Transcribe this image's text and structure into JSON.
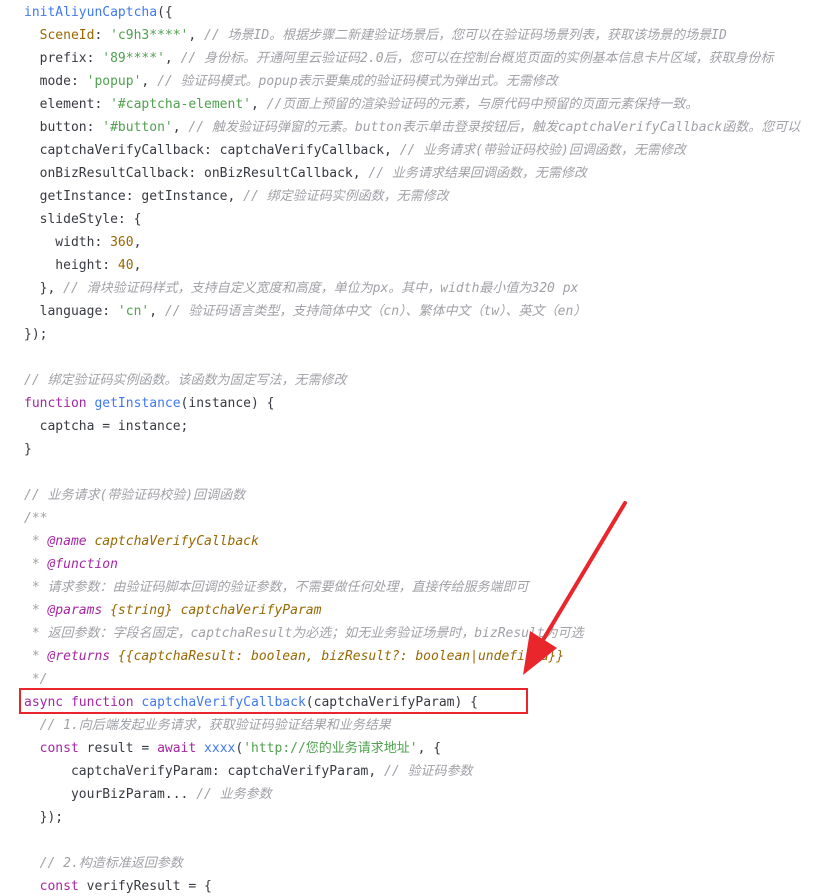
{
  "code": {
    "lines": [
      [
        [
          "fn",
          "initAliyunCaptcha"
        ],
        [
          "pl",
          "({"
        ]
      ],
      [
        [
          "pl",
          "  "
        ],
        [
          "var",
          "SceneId"
        ],
        [
          "pl",
          ": "
        ],
        [
          "str",
          "'c9h3****'"
        ],
        [
          "pl",
          ", "
        ],
        [
          "cm",
          "// 场景ID。根据步骤二新建验证场景后，您可以在验证码场景列表，获取该场景的场景ID"
        ]
      ],
      [
        [
          "pl",
          "  prefix: "
        ],
        [
          "str",
          "'89****'"
        ],
        [
          "pl",
          ", "
        ],
        [
          "cm",
          "// 身份标。开通阿里云验证码2.0后，您可以在控制台概览页面的实例基本信息卡片区域，获取身份标"
        ]
      ],
      [
        [
          "pl",
          "  mode: "
        ],
        [
          "str",
          "'popup'"
        ],
        [
          "pl",
          ", "
        ],
        [
          "cm",
          "// 验证码模式。popup表示要集成的验证码模式为弹出式。无需修改"
        ]
      ],
      [
        [
          "pl",
          "  element: "
        ],
        [
          "str",
          "'#captcha-element'"
        ],
        [
          "pl",
          ", "
        ],
        [
          "cm",
          "//页面上预留的渲染验证码的元素，与原代码中预留的页面元素保持一致。"
        ]
      ],
      [
        [
          "pl",
          "  button: "
        ],
        [
          "str",
          "'#button'"
        ],
        [
          "pl",
          ", "
        ],
        [
          "cm",
          "// 触发验证码弹窗的元素。button表示单击登录按钮后，触发captchaVerifyCallback函数。您可以"
        ]
      ],
      [
        [
          "pl",
          "  captchaVerifyCallback: captchaVerifyCallback, "
        ],
        [
          "cm",
          "// 业务请求(带验证码校验)回调函数，无需修改"
        ]
      ],
      [
        [
          "pl",
          "  onBizResultCallback: onBizResultCallback, "
        ],
        [
          "cm",
          "// 业务请求结果回调函数，无需修改"
        ]
      ],
      [
        [
          "pl",
          "  getInstance: getInstance, "
        ],
        [
          "cm",
          "// 绑定验证码实例函数，无需修改"
        ]
      ],
      [
        [
          "pl",
          "  slideStyle: {"
        ]
      ],
      [
        [
          "pl",
          "    width: "
        ],
        [
          "num",
          "360"
        ],
        [
          "pl",
          ","
        ]
      ],
      [
        [
          "pl",
          "    height: "
        ],
        [
          "num",
          "40"
        ],
        [
          "pl",
          ","
        ]
      ],
      [
        [
          "pl",
          "  }, "
        ],
        [
          "cm",
          "// 滑块验证码样式，支持自定义宽度和高度，单位为px。其中，width最小值为320 px"
        ]
      ],
      [
        [
          "pl",
          "  language: "
        ],
        [
          "str",
          "'cn'"
        ],
        [
          "pl",
          ", "
        ],
        [
          "cm",
          "// 验证码语言类型，支持简体中文（cn）、繁体中文（tw）、英文（en）"
        ]
      ],
      [
        [
          "pl",
          "});"
        ]
      ],
      [],
      [
        [
          "cm",
          "// 绑定验证码实例函数。该函数为固定写法，无需修改"
        ]
      ],
      [
        [
          "kw",
          "function"
        ],
        [
          "pl",
          " "
        ],
        [
          "fn",
          "getInstance"
        ],
        [
          "pl",
          "(instance) {"
        ]
      ],
      [
        [
          "pl",
          "  captcha = instance;"
        ]
      ],
      [
        [
          "pl",
          "}"
        ]
      ],
      [],
      [
        [
          "cm",
          "// 业务请求(带验证码校验)回调函数"
        ]
      ],
      [
        [
          "cm",
          "/**"
        ]
      ],
      [
        [
          "cm",
          " * "
        ],
        [
          "tag",
          "@name"
        ],
        [
          "cm",
          " "
        ],
        [
          "type",
          "captchaVerifyCallback"
        ]
      ],
      [
        [
          "cm",
          " * "
        ],
        [
          "tag",
          "@function"
        ]
      ],
      [
        [
          "cm",
          " * 请求参数：由验证码脚本回调的验证参数，不需要做任何处理，直接传给服务端即可"
        ]
      ],
      [
        [
          "cm",
          " * "
        ],
        [
          "tag",
          "@params"
        ],
        [
          "cm",
          " "
        ],
        [
          "type",
          "{string}"
        ],
        [
          "cm",
          " "
        ],
        [
          "type",
          "captchaVerifyParam"
        ]
      ],
      [
        [
          "cm",
          " * 返回参数：字段名固定，captchaResult为必选；如无业务验证场景时，bizResult为可选"
        ]
      ],
      [
        [
          "cm",
          " * "
        ],
        [
          "tag",
          "@returns"
        ],
        [
          "cm",
          " "
        ],
        [
          "type",
          "{{captchaResult: boolean, bizResult?: boolean|undefined}}"
        ]
      ],
      [
        [
          "cm",
          " */"
        ]
      ],
      [
        [
          "kw",
          "async"
        ],
        [
          "pl",
          " "
        ],
        [
          "kw",
          "function"
        ],
        [
          "pl",
          " "
        ],
        [
          "fn",
          "captchaVerifyCallback"
        ],
        [
          "pl",
          "(captchaVerifyParam) {"
        ]
      ],
      [
        [
          "pl",
          "  "
        ],
        [
          "cm",
          "// 1.向后端发起业务请求，获取验证码验证结果和业务结果"
        ]
      ],
      [
        [
          "pl",
          "  "
        ],
        [
          "kw",
          "const"
        ],
        [
          "pl",
          " result = "
        ],
        [
          "kw",
          "await"
        ],
        [
          "pl",
          " "
        ],
        [
          "fn",
          "xxxx"
        ],
        [
          "pl",
          "("
        ],
        [
          "str",
          "'http://您的业务请求地址'"
        ],
        [
          "pl",
          ", {"
        ]
      ],
      [
        [
          "pl",
          "      captchaVerifyParam: captchaVerifyParam, "
        ],
        [
          "cm",
          "// 验证码参数"
        ]
      ],
      [
        [
          "pl",
          "      yourBizParam... "
        ],
        [
          "cm",
          "// 业务参数"
        ]
      ],
      [
        [
          "pl",
          "  });"
        ]
      ],
      [],
      [
        [
          "pl",
          "  "
        ],
        [
          "cm",
          "// 2.构造标准返回参数"
        ]
      ],
      [
        [
          "pl",
          "  "
        ],
        [
          "kw",
          "const"
        ],
        [
          "pl",
          " verifyResult = {"
        ]
      ]
    ]
  },
  "annotation": {
    "box_color": "#e8262b",
    "arrow_color": "#e8262b"
  }
}
